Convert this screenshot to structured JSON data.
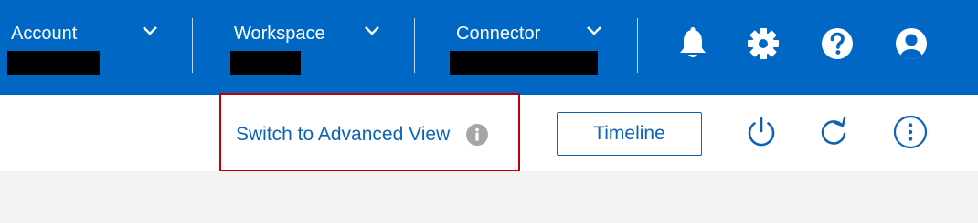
{
  "header": {
    "background": "#0067c5",
    "selectors": [
      {
        "label": "Account"
      },
      {
        "label": "Workspace"
      },
      {
        "label": "Connector"
      }
    ],
    "icons": [
      "bell-icon",
      "gear-icon",
      "help-icon",
      "user-icon"
    ]
  },
  "toolbar": {
    "advanced_view_label": "Switch to Advanced View",
    "timeline_label": "Timeline",
    "icons": [
      "info-icon",
      "power-icon",
      "refresh-icon",
      "more-vertical-icon"
    ],
    "accent": "#0c63b6",
    "highlight_color": "#c00000"
  }
}
